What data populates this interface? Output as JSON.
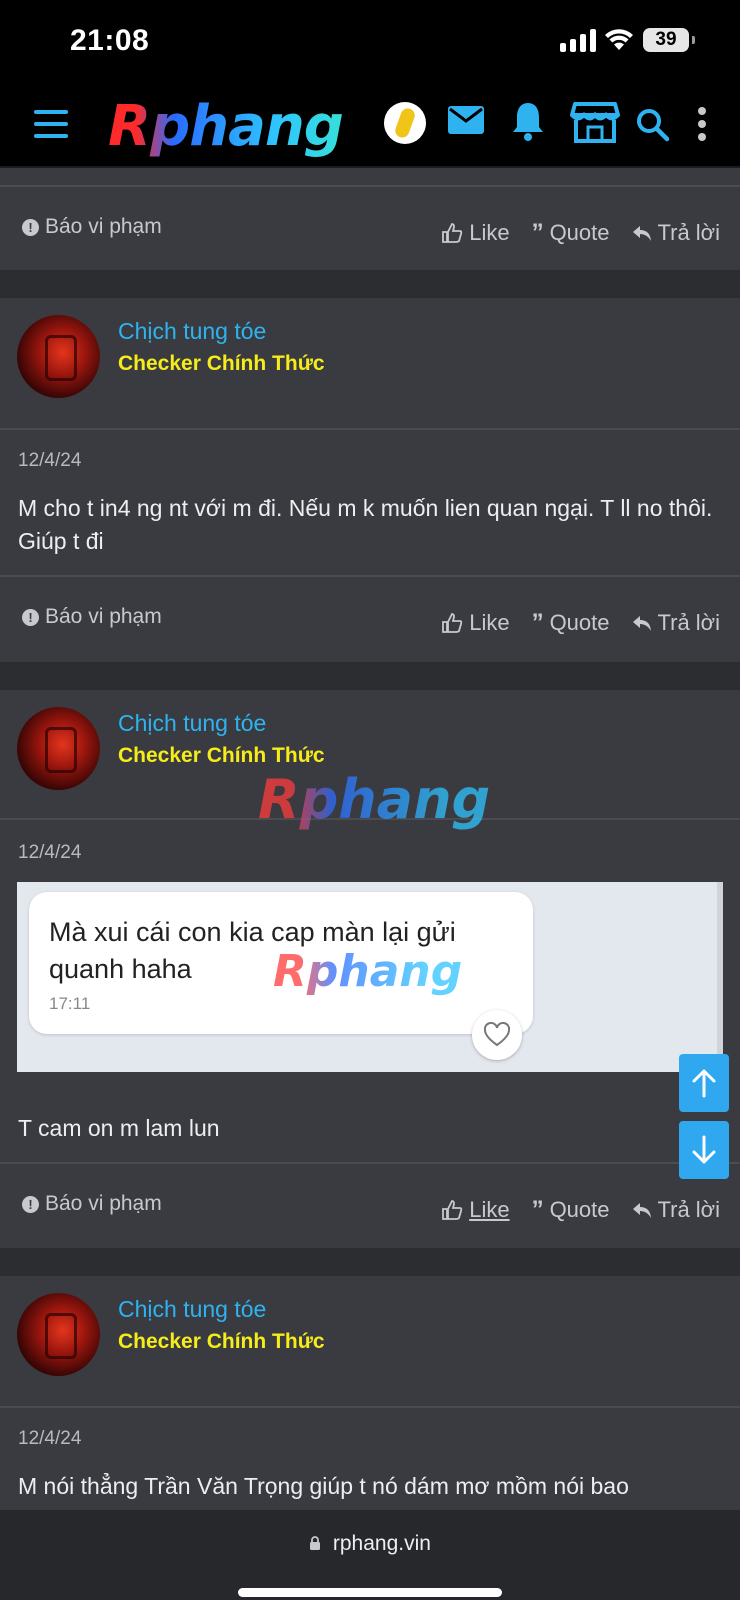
{
  "status_bar": {
    "time": "21:08",
    "battery": "39"
  },
  "header": {
    "logo": "Rphang"
  },
  "post0": {
    "report": "Báo vi phạm",
    "like": "Like",
    "quote": "Quote",
    "reply": "Trả lời"
  },
  "post1": {
    "username": "Chịch tung tóe",
    "user_title": "Checker Chính Thức",
    "date": "12/4/24",
    "text": "M cho t in4 ng nt với m đi. Nếu m k muốn lien quan ngại. T ll no thôi. Giúp t đi",
    "report": "Báo vi phạm",
    "like": "Like",
    "quote": "Quote",
    "reply": "Trả lời"
  },
  "post2": {
    "username": "Chịch tung tóe",
    "user_title": "Checker Chính Thức",
    "watermark": "Rphang",
    "date": "12/4/24",
    "image_text": "Mà xui cái con kia cap màn lại gửi quanh haha",
    "image_time": "17:11",
    "image_watermark": "Rphang",
    "text": "T cam on m lam lun",
    "report": "Báo vi phạm",
    "like": "Like",
    "quote": "Quote",
    "reply": "Trả lời"
  },
  "post3": {
    "username": "Chịch tung tóe",
    "user_title": "Checker Chính Thức",
    "date": "12/4/24",
    "text": "M nói thẳng Trần Văn Trọng giúp t nó dám mơ mồm nói bao"
  },
  "browser": {
    "url": "rphang.vin"
  },
  "colors": {
    "accent": "#2fb3f0",
    "title_yellow": "#f5ec1a",
    "post_bg": "#393b40"
  }
}
